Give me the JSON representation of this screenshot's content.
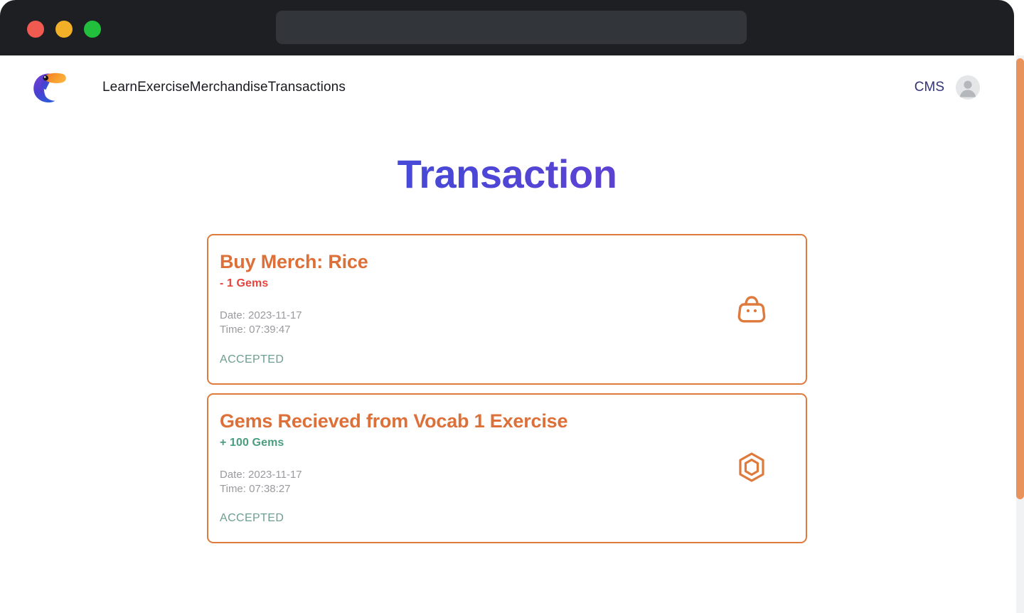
{
  "window": {
    "traffic_lights": [
      {
        "name": "close",
        "color": "#f05a50"
      },
      {
        "name": "minimize",
        "color": "#f2b028"
      },
      {
        "name": "maximize",
        "color": "#21bf3b"
      }
    ],
    "address_bar": {
      "value": "",
      "placeholder": ""
    }
  },
  "navbar": {
    "logo_alt": "toucan-logo",
    "links": [
      {
        "label": "Learn"
      },
      {
        "label": "Exercise"
      },
      {
        "label": "Merchandise"
      },
      {
        "label": "Transactions"
      }
    ],
    "cms_label": "CMS",
    "avatar_alt": "user-avatar"
  },
  "header": {
    "title": "Transaction",
    "title_gradient_from": "#3c5fe3",
    "title_gradient_to": "#8040c8"
  },
  "transactions": [
    {
      "title": "Buy Merch: Rice",
      "amount": "- 1 Gems",
      "amount_sign": "negative",
      "amount_color": "#e5453f",
      "date_label": "Date: 2023-11-17",
      "time_label": "Time: 07:39:47",
      "status": "ACCEPTED",
      "status_color": "#6c9e91",
      "icon": "shopping-bag-icon"
    },
    {
      "title": "Gems Recieved from Vocab 1 Exercise",
      "amount": "+ 100 Gems",
      "amount_sign": "positive",
      "amount_color": "#4a9e7f",
      "date_label": "Date: 2023-11-17",
      "time_label": "Time: 07:38:27",
      "status": "ACCEPTED",
      "status_color": "#6c9e91",
      "icon": "gem-hexagon-icon"
    }
  ],
  "theme": {
    "card_border": "#dd7a3c",
    "card_title": "#dd7038",
    "scrollbar_thumb": "#e9935c",
    "chrome_bg": "#1d1f23"
  }
}
